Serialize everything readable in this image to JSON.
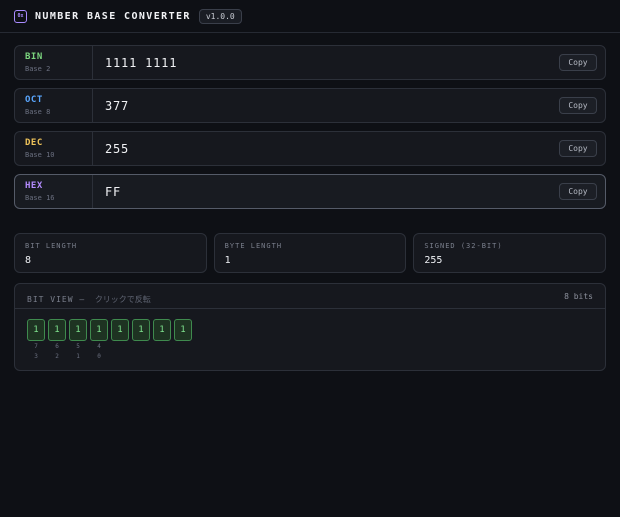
{
  "app": {
    "logo_text": "0x",
    "title": "NUMBER BASE CONVERTER",
    "version": "v1.0.0"
  },
  "rows": [
    {
      "name": "BIN",
      "base": "Base 2",
      "value": "1111 1111",
      "copy": "Copy",
      "color": "#7cd67f"
    },
    {
      "name": "OCT",
      "base": "Base 8",
      "value": "377",
      "copy": "Copy",
      "color": "#5aa7ff"
    },
    {
      "name": "DEC",
      "base": "Base 10",
      "value": "255",
      "copy": "Copy",
      "color": "#f0c45a"
    },
    {
      "name": "HEX",
      "base": "Base 16",
      "value": "FF",
      "copy": "Copy",
      "color": "#b48cff"
    }
  ],
  "stats": [
    {
      "label": "BIT LENGTH",
      "value": "8"
    },
    {
      "label": "BYTE LENGTH",
      "value": "1"
    },
    {
      "label": "SIGNED (32-BIT)",
      "value": "255"
    }
  ],
  "bitview": {
    "title": "BIT VIEW —",
    "subtitle": "クリックで反転",
    "count": "8 bits",
    "bits": [
      {
        "value": "1",
        "idx": "7",
        "idx2": "3"
      },
      {
        "value": "1",
        "idx": "6",
        "idx2": "2"
      },
      {
        "value": "1",
        "idx": "5",
        "idx2": "1"
      },
      {
        "value": "1",
        "idx": "4",
        "idx2": "0"
      },
      {
        "value": "1",
        "idx": "",
        "idx2": ""
      },
      {
        "value": "1",
        "idx": "",
        "idx2": ""
      },
      {
        "value": "1",
        "idx": "",
        "idx2": ""
      },
      {
        "value": "1",
        "idx": "",
        "idx2": ""
      }
    ]
  }
}
